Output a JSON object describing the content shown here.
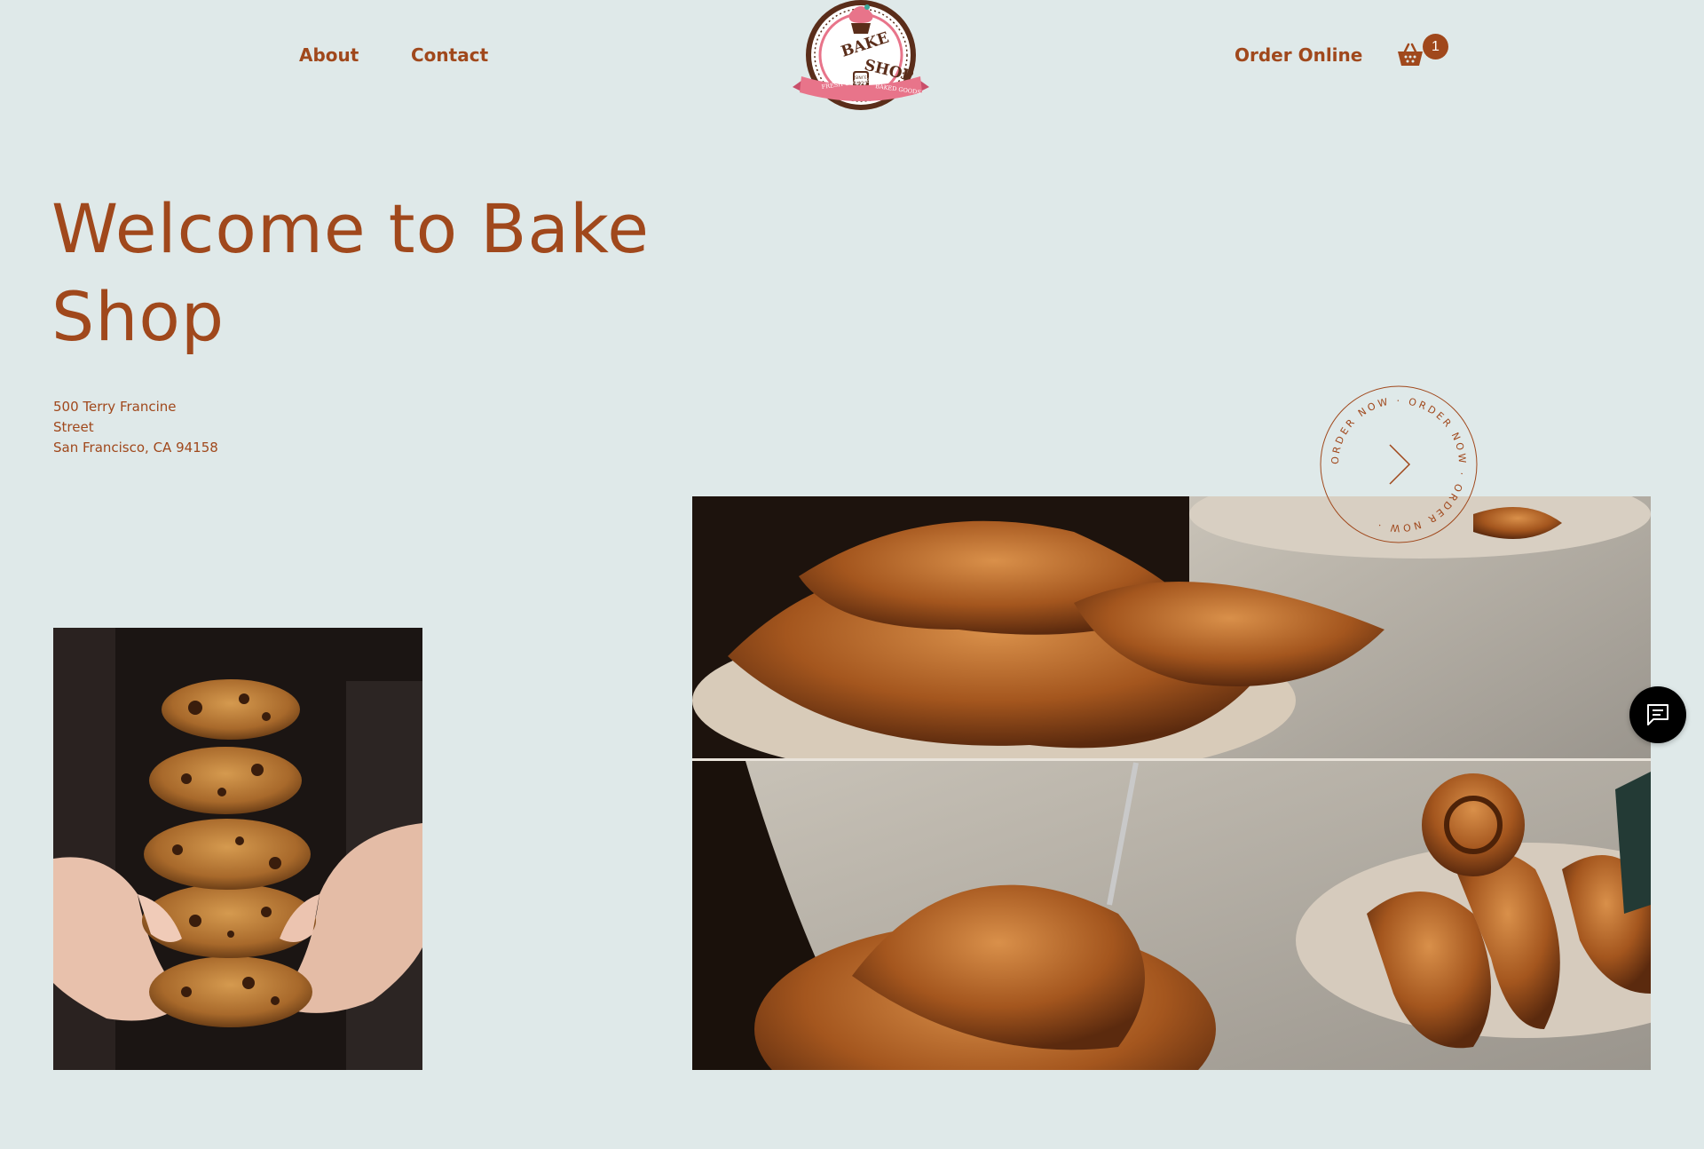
{
  "header": {
    "nav_left": [
      {
        "label": "About"
      },
      {
        "label": "Contact"
      }
    ],
    "order_online_label": "Order Online",
    "cart": {
      "icon": "basket-icon",
      "count": "1"
    },
    "logo": {
      "brand_text": "BAKE SHOP",
      "ribbon_left": "FRESH COFFEE",
      "ribbon_right": "BAKED GOODS",
      "since_label": "SINCE",
      "since_year": "1921"
    }
  },
  "hero": {
    "title": "Welcome to Bake Shop",
    "address": {
      "line1": "500 Terry Francine",
      "line2": "Street",
      "line3": "San Francisco, CA 94158"
    }
  },
  "order_badge": {
    "ring_text": "ORDER NOW · ORDER NOW · ORDER NOW · ",
    "icon": "chevron-right-icon"
  },
  "images": {
    "cookies": "hands holding a stack of chocolate chip cookies",
    "pastries": "croissants and pastries on plates on a marble counter"
  },
  "chat": {
    "icon": "chat-icon"
  },
  "colors": {
    "background": "#dfe9e9",
    "accent": "#a0481c",
    "logo_pink": "#e8748a",
    "logo_brown": "#5a2d1a"
  }
}
